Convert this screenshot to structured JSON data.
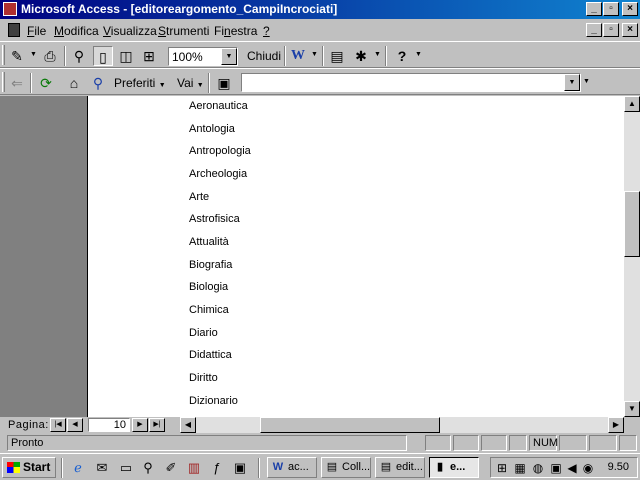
{
  "window": {
    "title": "Microsoft Access - [editoreargomento_CampiIncrociati]",
    "controls": {
      "minimize": "_",
      "maximize": "▫",
      "close": "×"
    }
  },
  "menubar": {
    "items": [
      {
        "key": "file",
        "pre": "",
        "accel": "F",
        "post": "ile"
      },
      {
        "key": "modifica",
        "pre": "",
        "accel": "M",
        "post": "odifica"
      },
      {
        "key": "visualizza",
        "pre": "",
        "accel": "V",
        "post": "isualizza"
      },
      {
        "key": "strumenti",
        "pre": "",
        "accel": "S",
        "post": "trumenti"
      },
      {
        "key": "finestra",
        "pre": "Fi",
        "accel": "n",
        "post": "estra"
      },
      {
        "key": "help",
        "pre": "",
        "accel": "?",
        "post": ""
      }
    ]
  },
  "print_toolbar": {
    "zoom_value": "100%",
    "close_label": "Chiudi"
  },
  "web_toolbar": {
    "favorites_label": "Preferiti",
    "go_label": "Vai",
    "address_value": ""
  },
  "report": {
    "rows": [
      "Aeronautica",
      "Antologia",
      "Antropologia",
      "Archeologia",
      "Arte",
      "Astrofisica",
      "Attualità",
      "Biografia",
      "Biologia",
      "Chimica",
      "Diario",
      "Didattica",
      "Diritto",
      "Dizionario"
    ]
  },
  "navigation": {
    "page_label": "Pagina:",
    "page_value": "10"
  },
  "statusbar": {
    "status_text": "Pronto",
    "num_indicator": "NUM"
  },
  "taskbar": {
    "start_label": "Start",
    "tasks": [
      {
        "label": "ac...",
        "icon": "word-doc-icon",
        "active": false
      },
      {
        "label": "Coll...",
        "icon": "window-icon",
        "active": false
      },
      {
        "label": "edit...",
        "icon": "window-icon",
        "active": false
      },
      {
        "label": "e...",
        "icon": "access-icon",
        "active": true
      }
    ],
    "clock": "9.50"
  },
  "colors": {
    "title_start": "#000080",
    "title_end": "#1084d0",
    "face": "#c0c0c0",
    "selector_gray": "#808080"
  }
}
